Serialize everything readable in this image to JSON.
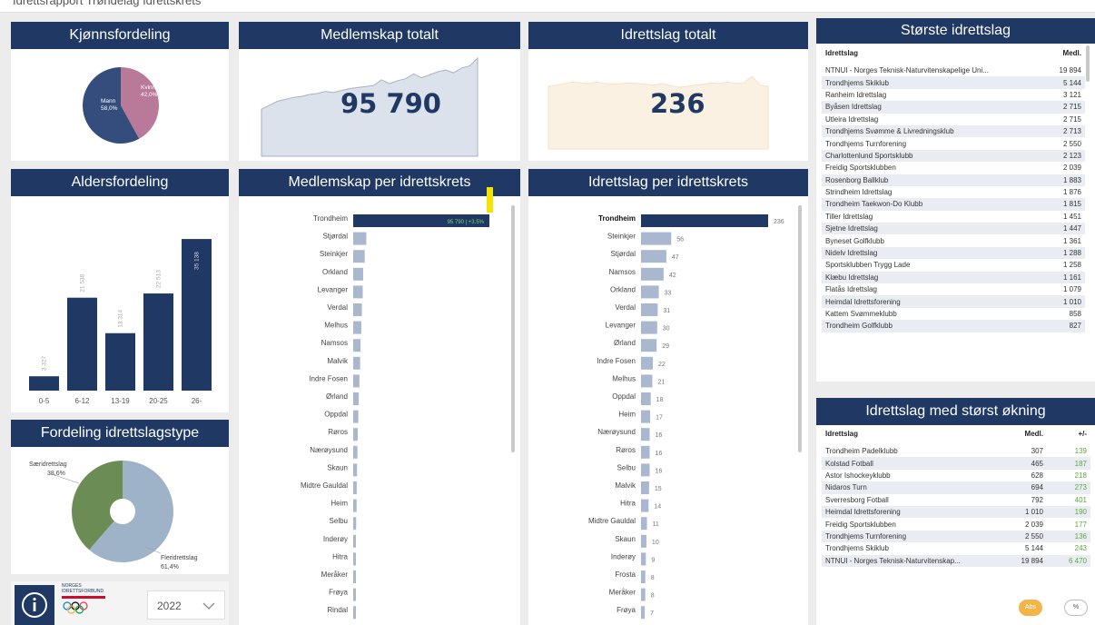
{
  "page": {
    "top_title": "Idrettsrapport Trøndelag Idrettskrets"
  },
  "colors": {
    "navy": "#1f3864",
    "bar": "#1f3864",
    "light_bar": "#aab8cf",
    "female": "#b97a9a",
    "male": "#344d7c",
    "green": "#6b8d55",
    "grey_blue": "#9fb3c8",
    "positive": "#5fa83c",
    "yellow": "#f2e400",
    "orange_toggle": "#f3b54a"
  },
  "gender": {
    "title": "Kjønnsfordeling",
    "male_label": "Mann",
    "male_pct": "58,0%",
    "female_label": "Kvinne",
    "female_pct": "42,0%"
  },
  "members_total": {
    "title": "Medlemskap totalt",
    "value": "95 790"
  },
  "clubs_total": {
    "title": "Idrettslag totalt",
    "value": "236"
  },
  "age": {
    "title": "Aldersfordeling",
    "categories": [
      "0-5",
      "6-12",
      "13-19",
      "20-25",
      "26-"
    ],
    "values_text": [
      "3 327",
      "21 538",
      "13 314",
      "22 513",
      "35 138"
    ]
  },
  "club_type": {
    "title": "Fordeling idrettslagstype",
    "special_label": "Særidrettslag",
    "special_pct": "38,6%",
    "multi_label": "Fleridrettslag",
    "multi_pct": "61,4%"
  },
  "footer": {
    "info_icon": "info-icon",
    "logo_line1": "NORGES",
    "logo_line2": "IDRETTSFORBUND",
    "year": "2022",
    "chevron": "chevron-down-icon"
  },
  "members_per_district": {
    "title": "Medlemskap per idrettskrets",
    "first_label": "95 790 | +3.5%"
  },
  "clubs_per_district": {
    "title": "Idrettslag per idrettskrets"
  },
  "largest_clubs": {
    "title": "Største idrettslag",
    "col_name": "Idrettslag",
    "col_members": "Medl.",
    "rows": [
      {
        "name": "NTNUI - Norges Teknisk-Naturvitenskapelige Uni...",
        "members": "19 894"
      },
      {
        "name": "Trondhjems Skiklub",
        "members": "5 144"
      },
      {
        "name": "Ranheim Idrettslag",
        "members": "3 121"
      },
      {
        "name": "Byåsen Idrettslag",
        "members": "2 715"
      },
      {
        "name": "Utleira Idrettslag",
        "members": "2 715"
      },
      {
        "name": "Trondhjems Svømme & Livredningsklub",
        "members": "2 713"
      },
      {
        "name": "Trondhjems Turnforening",
        "members": "2 550"
      },
      {
        "name": "Charlottenlund Sportsklubb",
        "members": "2 123"
      },
      {
        "name": "Freidig Sportsklubben",
        "members": "2 039"
      },
      {
        "name": "Rosenborg Ballklub",
        "members": "1 883"
      },
      {
        "name": "Strindheim Idrettslag",
        "members": "1 876"
      },
      {
        "name": "Trondheim Taekwon-Do Klubb",
        "members": "1 815"
      },
      {
        "name": "Tiller Idrettslag",
        "members": "1 451"
      },
      {
        "name": "Sjetne Idrettslag",
        "members": "1 447"
      },
      {
        "name": "Byneset Golfklubb",
        "members": "1 361"
      },
      {
        "name": "Nidelv Idrettslag",
        "members": "1 288"
      },
      {
        "name": "Sportsklubben Trygg Lade",
        "members": "1 258"
      },
      {
        "name": "Klæbu Idrettslag",
        "members": "1 161"
      },
      {
        "name": "Flatås Idrettslag",
        "members": "1 079"
      },
      {
        "name": "Heimdal Idrettsforening",
        "members": "1 010"
      },
      {
        "name": "Kattem Svømmeklubb",
        "members": "858"
      },
      {
        "name": "Trondheim Golfklubb",
        "members": "827"
      }
    ]
  },
  "growth": {
    "title": "Idrettslag med størst økning",
    "col_name": "Idrettslag",
    "col_members": "Medl.",
    "col_change": "+/-",
    "rows": [
      {
        "name": "Trondheim Padelklubb",
        "members": "307",
        "change": "139"
      },
      {
        "name": "Kolstad Fotball",
        "members": "465",
        "change": "187"
      },
      {
        "name": "Astor Ishockeyklubb",
        "members": "628",
        "change": "218"
      },
      {
        "name": "Nidaros Turn",
        "members": "694",
        "change": "273"
      },
      {
        "name": "Sverresborg Fotball",
        "members": "792",
        "change": "401"
      },
      {
        "name": "Heimdal Idrettsforening",
        "members": "1 010",
        "change": "190"
      },
      {
        "name": "Freidig Sportsklubben",
        "members": "2 039",
        "change": "177"
      },
      {
        "name": "Trondhjems Turnforening",
        "members": "2 550",
        "change": "136"
      },
      {
        "name": "Trondhjems Skiklub",
        "members": "5 144",
        "change": "243"
      },
      {
        "name": "NTNUI - Norges Teknisk-Naturvitenskap...",
        "members": "19 894",
        "change": "6 470"
      }
    ],
    "toggle_abs": "Abs",
    "toggle_pct": "%"
  },
  "chart_data": [
    {
      "type": "pie",
      "title": "Kjønnsfordeling",
      "labels": [
        "Mann",
        "Kvinne"
      ],
      "values": [
        58.0,
        42.0
      ]
    },
    {
      "type": "area",
      "title": "Medlemskap totalt",
      "values": [
        48,
        52,
        56,
        58,
        60,
        61,
        63,
        64,
        66,
        65,
        67,
        69,
        70,
        71,
        72,
        78,
        74,
        77,
        79,
        84,
        80,
        83,
        86,
        88,
        85,
        90,
        92,
        100
      ],
      "ylim": [
        0,
        100
      ]
    },
    {
      "type": "area",
      "title": "Idrettslag totalt",
      "values": [
        86,
        88,
        90,
        92,
        91,
        90,
        92,
        90,
        89,
        90,
        91,
        90,
        89,
        88,
        90,
        87,
        85,
        86,
        88,
        89,
        91,
        90,
        92,
        90,
        91,
        100,
        88,
        86
      ],
      "ylim": [
        0,
        100
      ]
    },
    {
      "type": "bar",
      "title": "Aldersfordeling",
      "categories": [
        "0-5",
        "6-12",
        "13-19",
        "20-25",
        "26-"
      ],
      "values": [
        3327,
        21538,
        13314,
        22513,
        35138
      ]
    },
    {
      "type": "pie",
      "title": "Fordeling idrettslagstype",
      "labels": [
        "Særidrettslag",
        "Fleridrettslag"
      ],
      "values": [
        38.6,
        61.4
      ]
    },
    {
      "type": "bar",
      "title": "Medlemskap per idrettskrets",
      "categories": [
        "Trondheim",
        "Stjørdal",
        "Steinkjer",
        "Orkland",
        "Levanger",
        "Verdal",
        "Melhus",
        "Namsos",
        "Malvik",
        "Indre Fosen",
        "Ørland",
        "Oppdal",
        "Røros",
        "Nærøysund",
        "Skaun",
        "Midtre Gauldal",
        "Heim",
        "Selbu",
        "Inderøy",
        "Hitra",
        "Meråker",
        "Frøya",
        "Rindal"
      ],
      "values": [
        95790,
        9200,
        8100,
        7000,
        6700,
        6100,
        5700,
        5100,
        4900,
        4400,
        3900,
        3600,
        3200,
        3000,
        2700,
        2500,
        2400,
        2100,
        1900,
        1700,
        1500,
        1300,
        900
      ]
    },
    {
      "type": "bar",
      "title": "Idrettslag per idrettskrets",
      "categories": [
        "Trondheim",
        "Steinkjer",
        "Stjørdal",
        "Namsos",
        "Orkland",
        "Verdal",
        "Levanger",
        "Ørland",
        "Indre Fosen",
        "Melhus",
        "Oppdal",
        "Heim",
        "Nærøysund",
        "Røros",
        "Selbu",
        "Malvik",
        "Hitra",
        "Midtre Gauldal",
        "Skaun",
        "Inderøy",
        "Frosta",
        "Meråker",
        "Frøya"
      ],
      "values": [
        236,
        56,
        47,
        42,
        33,
        31,
        30,
        29,
        22,
        21,
        18,
        17,
        16,
        16,
        16,
        15,
        14,
        11,
        10,
        9,
        8,
        8,
        7
      ]
    }
  ]
}
